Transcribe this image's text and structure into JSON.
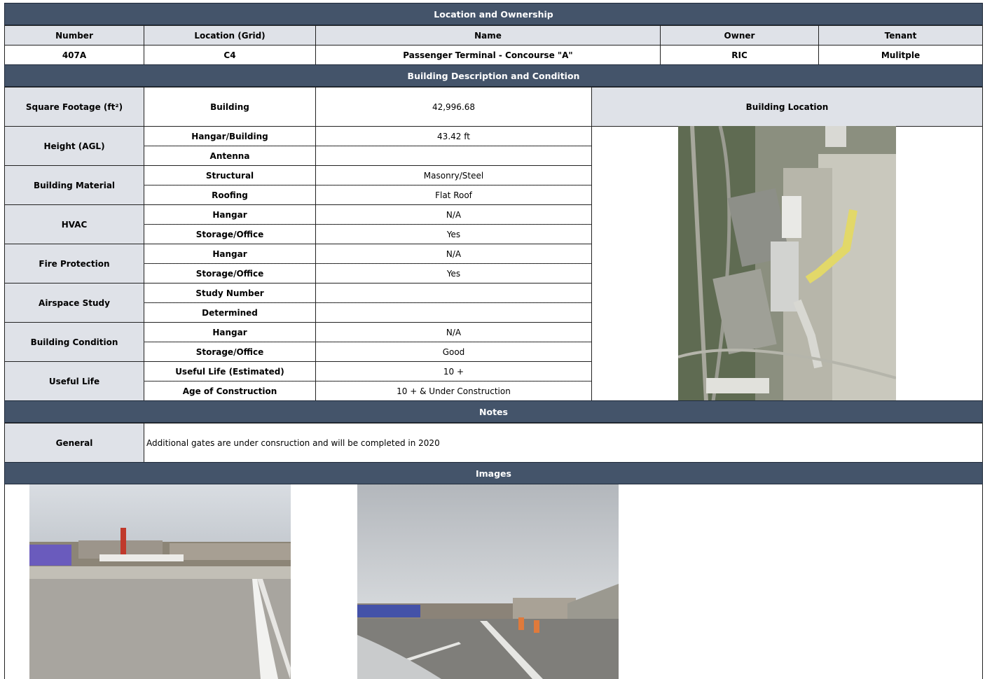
{
  "ownership": {
    "band": "Location and Ownership",
    "headers": {
      "number": "Number",
      "location": "Location (Grid)",
      "name": "Name",
      "owner": "Owner",
      "tenant": "Tenant"
    },
    "values": {
      "number": "407A",
      "location": "C4",
      "name": "Passenger Terminal - Concourse \"A\"",
      "owner": "RIC",
      "tenant": "Mulitple"
    }
  },
  "description": {
    "band": "Building Description and Condition",
    "location_header": "Building Location",
    "rows": [
      {
        "group": "Square Footage (ft²)",
        "items": [
          {
            "label": "Building",
            "value": "42,996.68"
          }
        ]
      },
      {
        "group": "Height (AGL)",
        "items": [
          {
            "label": "Hangar/Building",
            "value": "43.42 ft"
          },
          {
            "label": "Antenna",
            "value": ""
          }
        ]
      },
      {
        "group": "Building Material",
        "items": [
          {
            "label": "Structural",
            "value": "Masonry/Steel"
          },
          {
            "label": "Roofing",
            "value": "Flat Roof"
          }
        ]
      },
      {
        "group": "HVAC",
        "items": [
          {
            "label": "Hangar",
            "value": "N/A"
          },
          {
            "label": "Storage/Office",
            "value": "Yes"
          }
        ]
      },
      {
        "group": "Fire Protection",
        "items": [
          {
            "label": "Hangar",
            "value": "N/A"
          },
          {
            "label": "Storage/Office",
            "value": "Yes"
          }
        ]
      },
      {
        "group": "Airspace Study",
        "items": [
          {
            "label": "Study Number",
            "value": ""
          },
          {
            "label": "Determined",
            "value": ""
          }
        ]
      },
      {
        "group": "Building Condition",
        "items": [
          {
            "label": "Hangar",
            "value": "N/A"
          },
          {
            "label": "Storage/Office",
            "value": "Good"
          }
        ]
      },
      {
        "group": "Useful Life",
        "items": [
          {
            "label": "Useful Life (Estimated)",
            "value": "10 +"
          },
          {
            "label": "Age of Construction",
            "value": "10 + & Under Construction"
          }
        ]
      }
    ]
  },
  "notes": {
    "band": "Notes",
    "label": "General",
    "text": "Additional gates are under consruction and will be completed in 2020"
  },
  "images": {
    "band": "Images"
  }
}
